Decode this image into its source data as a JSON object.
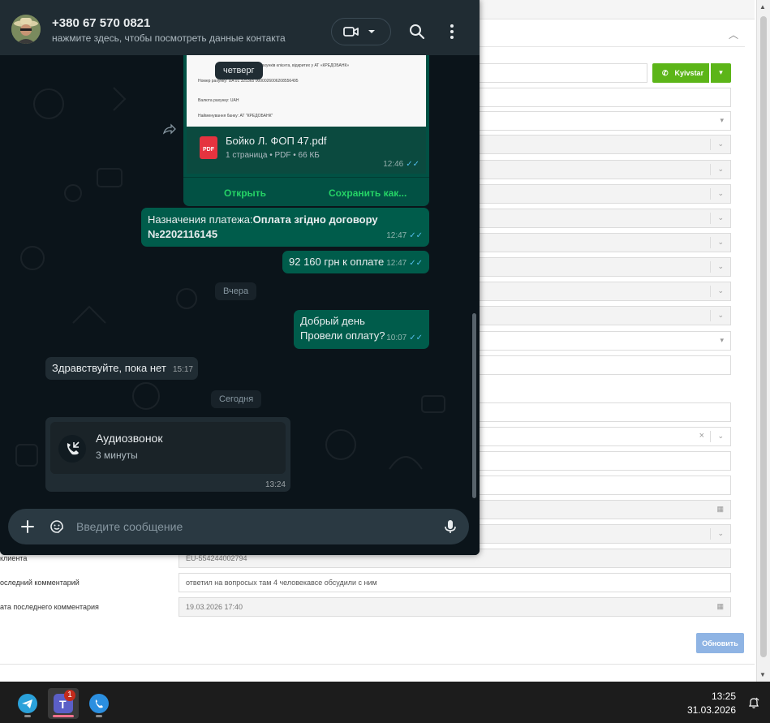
{
  "contact": {
    "name": "+380 67 570 0821",
    "subtitle": "нажмите здесь, чтобы посмотреть данные контакта"
  },
  "messages": {
    "pdf": {
      "date_chip": "четверг",
      "preview_lines": [
        "рахунків клієнта, відкритих у АТ «КРЕДОБАНК»",
        "Номер рахунку:  UA 01 325365 0000026006208556495",
        "Валюта рахунку:  UAH",
        "Найменування банку:  АТ \"КРЕДОБАНК\""
      ],
      "filename": "Бойко Л. ФОП 47.pdf",
      "meta": "1 страница • PDF • 66 КБ",
      "icon_label": "PDF",
      "time": "12:46",
      "open_label": "Открыть",
      "save_label": "Сохранить как..."
    },
    "payment": {
      "prefix": "Назначения платежа:",
      "bold": "Оплата згідно договору №2202116145",
      "time": "12:47"
    },
    "amount": {
      "text": "92 160 грн к оплате",
      "time": "12:47"
    },
    "chip_yesterday": "Вчера",
    "greeting": {
      "line1": "Добрый день",
      "line2": "Провели оплату?",
      "time": "10:07"
    },
    "reply": {
      "text": "Здравствуйте, пока нет",
      "time": "15:17"
    },
    "chip_today": "Сегодня",
    "call": {
      "title": "Аудиозвонок",
      "duration": "3 минуты",
      "time": "13:24"
    }
  },
  "composer": {
    "placeholder": "Введите сообщение"
  },
  "background_form": {
    "carrier_button": "Kyivstar",
    "labels": {
      "client": "клиента",
      "last_comment": "оследний комментарий",
      "last_comment_date": "ата последнего комментария"
    },
    "values": {
      "client_id": "EU-554244002794",
      "last_comment": "ответил на вопросых там 4 человекавсе обсудили с ним",
      "last_comment_date": "19.03.2026 17:40"
    },
    "update_button": "Обновить"
  },
  "taskbar": {
    "teams_badge": "1",
    "time": "13:25",
    "date": "31.03.2026"
  },
  "colors": {
    "outgoing_bubble": "#005c4b",
    "incoming_bubble": "#202c33",
    "accent_green": "#25d366",
    "read_ticks": "#53bdeb",
    "kyivstar_green": "#5cb518",
    "update_button": "#8fb4e4"
  },
  "icons": [
    "video-camera-icon",
    "search-icon",
    "kebab-menu-icon",
    "pdf-icon",
    "forward-icon",
    "double-check-icon",
    "incoming-call-icon",
    "plus-icon",
    "sticker-icon",
    "microphone-icon",
    "phone-icon",
    "telegram-icon",
    "teams-icon",
    "viber-icon",
    "notification-bell-icon"
  ]
}
